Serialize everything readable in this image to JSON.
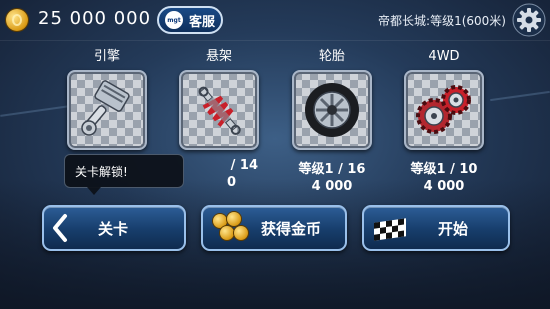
{
  "header": {
    "coins": "25 000 000",
    "service_label": "客服",
    "service_badge": "mgt",
    "track_info": "帝都长城:等级1(600米)",
    "settings_icon": "gear-icon"
  },
  "upgrades": [
    {
      "name": "引擎",
      "icon": "piston-icon",
      "level": "",
      "cost": ""
    },
    {
      "name": "悬架",
      "icon": "shock-absorber-icon",
      "level": "/ 14",
      "cost": "0"
    },
    {
      "name": "轮胎",
      "icon": "wheel-icon",
      "level": "等级1 / 16",
      "cost": "4 000"
    },
    {
      "name": "4WD",
      "icon": "gears-icon",
      "level": "等级1 / 10",
      "cost": "4 000"
    }
  ],
  "tooltip": "关卡解锁!",
  "buttons": {
    "levels": "关卡",
    "get_coins": "获得金币",
    "start": "开始"
  },
  "colors": {
    "button_fill": "#173d6b",
    "button_border": "#9ac0ea",
    "accent_red": "#c8202a",
    "coin_gold": "#d99a14"
  }
}
